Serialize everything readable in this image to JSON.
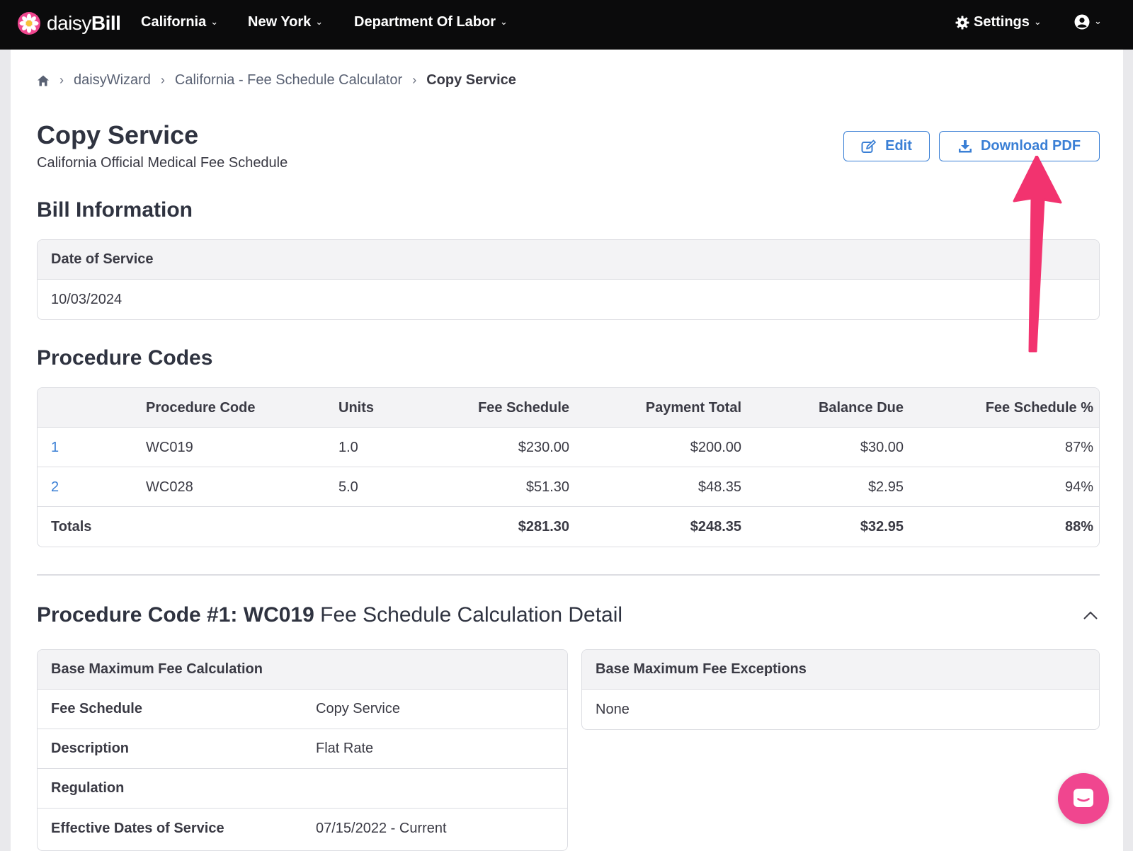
{
  "nav": {
    "brand_light": "daisy",
    "brand_bold": "Bill",
    "items": [
      "California",
      "New York",
      "Department Of Labor"
    ],
    "settings_label": "Settings"
  },
  "breadcrumb": {
    "items": [
      "daisyWizard",
      "California - Fee Schedule Calculator"
    ],
    "current": "Copy Service"
  },
  "page": {
    "title": "Copy Service",
    "subtitle": "California Official Medical Fee Schedule",
    "edit_label": "Edit",
    "download_label": "Download PDF"
  },
  "bill_info": {
    "title": "Bill Information",
    "date_label": "Date of Service",
    "date_value": "10/03/2024"
  },
  "procedure_codes": {
    "title": "Procedure Codes",
    "columns": [
      "",
      "Procedure Code",
      "Units",
      "Fee Schedule",
      "Payment Total",
      "Balance Due",
      "Fee Schedule %"
    ],
    "rows": [
      [
        "1",
        "WC019",
        "1.0",
        "$230.00",
        "$200.00",
        "$30.00",
        "87%"
      ],
      [
        "2",
        "WC028",
        "5.0",
        "$51.30",
        "$48.35",
        "$2.95",
        "94%"
      ]
    ],
    "totals": [
      "Totals",
      "",
      "",
      "$281.30",
      "$248.35",
      "$32.95",
      "88%"
    ]
  },
  "detail": {
    "title_bold": "Procedure Code #1: WC019",
    "title_light": " Fee Schedule Calculation Detail",
    "calc": {
      "header": "Base Maximum Fee Calculation",
      "rows": [
        [
          "Fee Schedule",
          "Copy Service"
        ],
        [
          "Description",
          "Flat Rate"
        ],
        [
          "Regulation",
          ""
        ],
        [
          "Effective Dates of Service",
          "07/15/2022 - Current"
        ]
      ]
    },
    "exceptions": {
      "header": "Base Maximum Fee Exceptions",
      "value": "None"
    }
  },
  "colors": {
    "accent": "#3a7fd5",
    "nav_bg": "#0b0b0c",
    "chat": "#f0468f",
    "arrow": "#f2336f"
  }
}
